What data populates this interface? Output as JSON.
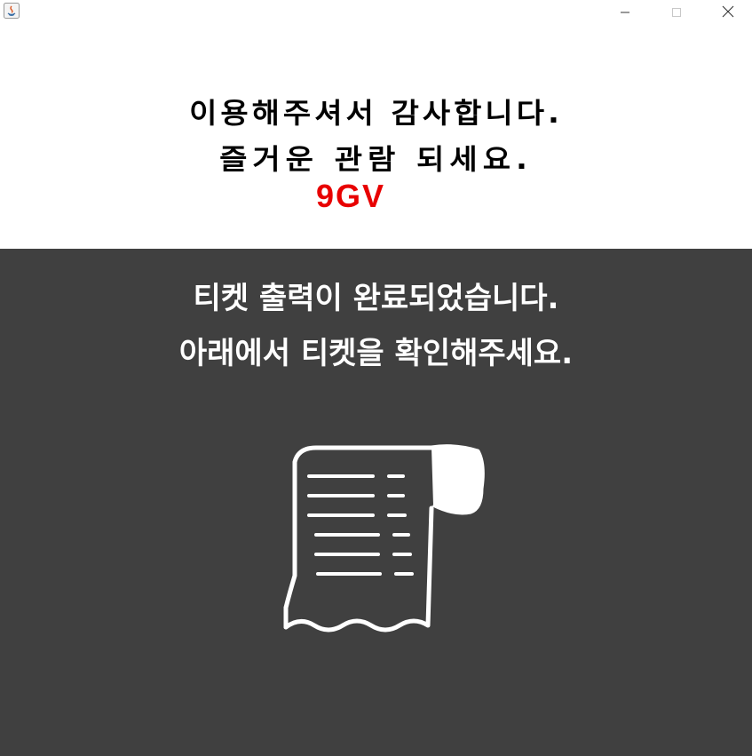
{
  "window": {
    "title_icon": "java-app-icon",
    "controls": [
      "minimize-icon",
      "maximize-icon",
      "close-icon"
    ]
  },
  "banner": {
    "line1": "이용해주셔서 감사합니다.",
    "line2": "즐거운 관람 되세요.",
    "brand": "9GV",
    "brand_color": "#e80000"
  },
  "panel": {
    "background": "#404040",
    "message_line1": "티켓 출력이 완료되었습니다.",
    "message_line2": "아래에서 티켓을 확인해주세요.",
    "icon": "receipt-icon"
  }
}
